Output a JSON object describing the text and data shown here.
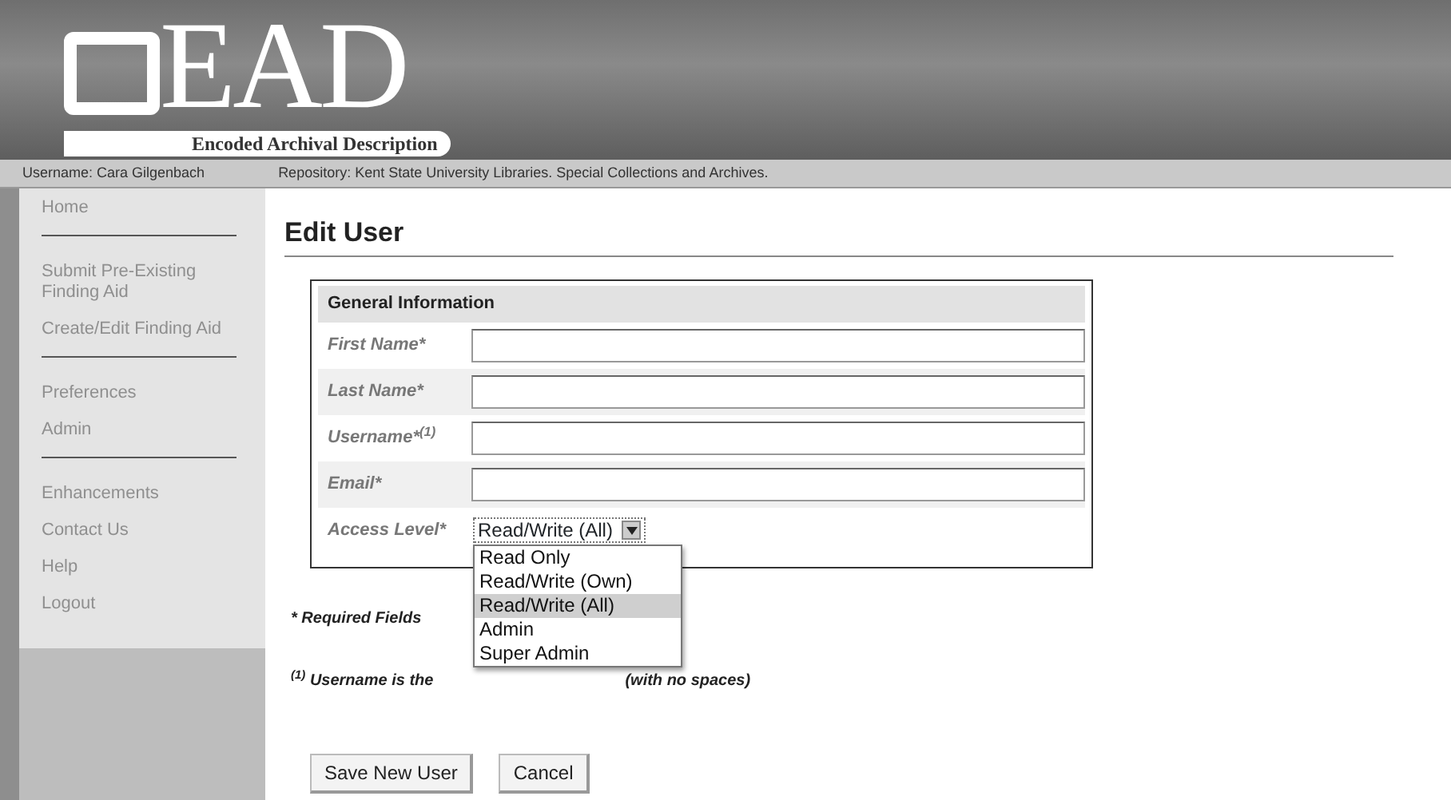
{
  "header": {
    "logo_text": "EAD",
    "logo_subtitle": "Encoded Archival Description"
  },
  "status_bar": {
    "username": "Username: Cara Gilgenbach",
    "repository": "Repository: Kent State University Libraries. Special Collections and Archives."
  },
  "sidebar": {
    "groups": [
      {
        "items": [
          "Home"
        ]
      },
      {
        "items": [
          "Submit Pre-Existing Finding Aid",
          "Create/Edit Finding Aid"
        ]
      },
      {
        "items": [
          "Preferences",
          "Admin"
        ]
      },
      {
        "items": [
          "Enhancements",
          "Contact Us",
          "Help",
          "Logout"
        ]
      }
    ]
  },
  "page_title": "Edit User",
  "form": {
    "section_title": "General Information",
    "fields": [
      {
        "label": "First Name*",
        "kind": "text"
      },
      {
        "label": "Last Name*",
        "kind": "text"
      },
      {
        "label": "Username*$^{(1)}$",
        "kind": "text"
      },
      {
        "label": "Email*",
        "kind": "text"
      },
      {
        "label": "Access Level*",
        "kind": "select",
        "value": "Read/Write (All)",
        "expanded": true,
        "options": [
          {
            "label": "Read Only",
            "selected": false
          },
          {
            "label": "Read/Write (Own)",
            "selected": false
          },
          {
            "label": "Read/Write (All)",
            "selected": true
          },
          {
            "label": "Admin",
            "selected": false
          },
          {
            "label": "Super Admin",
            "selected": false
          }
        ]
      }
    ]
  },
  "required_note": "* Required Fields",
  "footnote": [
    "$^{(1)}$ Username is the",
    "(with no spaces)"
  ],
  "buttons": [
    "Save New User",
    "Cancel"
  ]
}
